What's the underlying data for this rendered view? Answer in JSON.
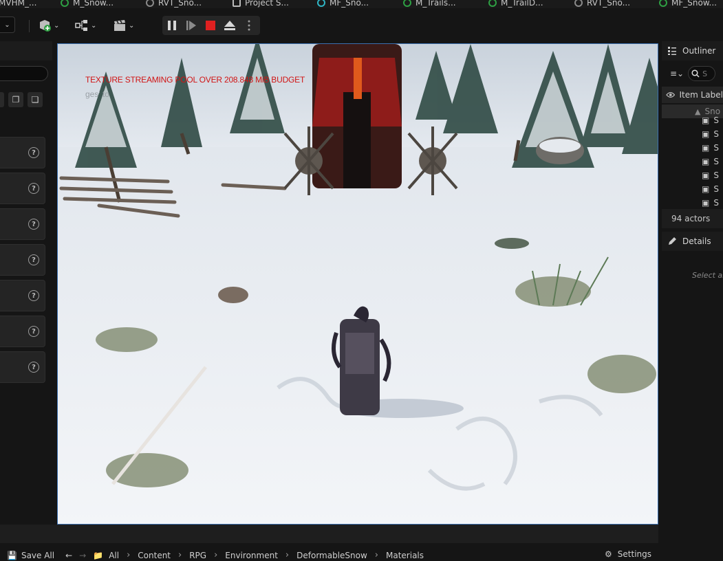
{
  "tabs": [
    {
      "label": "MVHM_...",
      "icon": "material-instance-icon"
    },
    {
      "label": "M_Snow...",
      "icon": "material-icon"
    },
    {
      "label": "RVT_Sno...",
      "icon": "runtime-virtual-texture-icon"
    },
    {
      "label": "Project S...",
      "icon": "project-settings-icon"
    },
    {
      "label": "MF_Sno...",
      "icon": "material-function-icon"
    },
    {
      "label": "M_Trails...",
      "icon": "material-icon"
    },
    {
      "label": "M_TrailD...",
      "icon": "material-icon"
    },
    {
      "label": "RVT_Sno...",
      "icon": "runtime-virtual-texture-icon"
    },
    {
      "label": "MF_Snow...",
      "icon": "material-function-icon"
    }
  ],
  "toolbar": {
    "add_icon": "add-actor-icon",
    "blueprint_icon": "blueprint-icon",
    "cinematics_icon": "clapperboard-icon",
    "play_controls": [
      "pause-icon",
      "step-frame-icon",
      "stop-icon",
      "eject-icon",
      "more-options-icon"
    ]
  },
  "viewport": {
    "warning": "TEXTURE STREAMING POOL OVER 208.848 MiB BUDGET",
    "warning_sub": "ges' to"
  },
  "outliner": {
    "title": "Outliner",
    "search_placeholder": "S",
    "column_header": "Item Label",
    "folder": "Sno",
    "items": [
      "S",
      "S",
      "S",
      "S",
      "S",
      "S",
      "S"
    ],
    "actor_count": "94 actors"
  },
  "details": {
    "title": "Details",
    "empty_text": "Select an"
  },
  "content_browser": {
    "save_all": "Save All",
    "breadcrumbs": [
      "All",
      "Content",
      "RPG",
      "Environment",
      "DeformableSnow",
      "Materials"
    ],
    "settings": "Settings"
  },
  "colors": {
    "accent_blue": "#3b6fb0",
    "warning_red": "#d11414",
    "stop_red": "#e02020",
    "material_green": "#2ea043"
  }
}
